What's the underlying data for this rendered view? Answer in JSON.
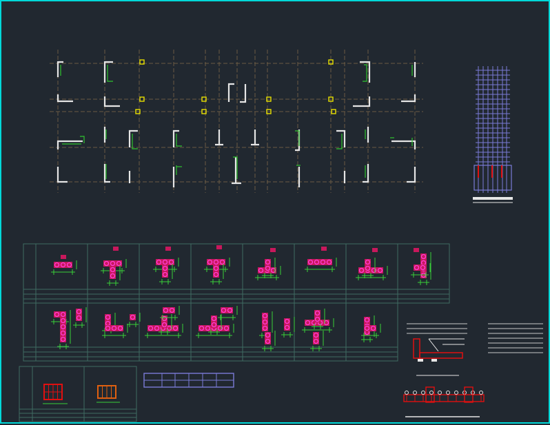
{
  "colors": {
    "background": "#212830",
    "frame": "#00d8d8",
    "wall": "#e6e6e6",
    "rebar": "#2fc52f",
    "column_marker": "#e8e000",
    "axis": "#6a5a44",
    "elevation": "#7b7bd8",
    "section_fill": "#c8185c",
    "section_dot": "#ff3dd8",
    "dimension": "#39d039",
    "table_line": "#3f6b62",
    "detail_red": "#e01010",
    "detail_orange": "#e06010",
    "legend_line": "#c8c8c8",
    "small_table": "#7b7bd8"
  },
  "drawing": {
    "plan": "shear-wall-layout-plan",
    "elevation": "rebar-elevation",
    "table_row1_cells": 8,
    "table_row2_cells": 7,
    "bottom_table_cells": 2
  }
}
